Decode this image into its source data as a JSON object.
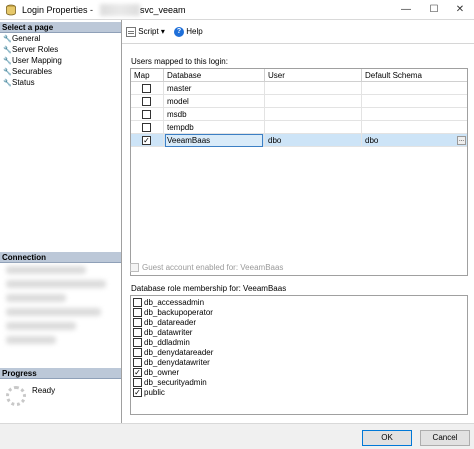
{
  "window": {
    "title": "Login Properties -",
    "login_name": "svc_veeam",
    "min_glyph": "—",
    "max_glyph": "☐",
    "close_glyph": "✕"
  },
  "left": {
    "select_header": "Select a page",
    "pages": [
      {
        "label": "General",
        "icon": "wrench-icon"
      },
      {
        "label": "Server Roles",
        "icon": "wrench-icon"
      },
      {
        "label": "User Mapping",
        "icon": "wrench-icon"
      },
      {
        "label": "Securables",
        "icon": "wrench-icon"
      },
      {
        "label": "Status",
        "icon": "wrench-icon"
      }
    ],
    "connection_header": "Connection",
    "progress_header": "Progress",
    "progress_status": "Ready"
  },
  "toolbar": {
    "script_label": "Script",
    "dropdown_glyph": "▾",
    "help_label": "Help",
    "help_glyph": "?"
  },
  "mapping": {
    "label": "Users mapped to this login:",
    "columns": [
      "Map",
      "Database",
      "User",
      "Default Schema"
    ],
    "rows": [
      {
        "checked": false,
        "database": "master",
        "user": "",
        "schema": ""
      },
      {
        "checked": false,
        "database": "model",
        "user": "",
        "schema": ""
      },
      {
        "checked": false,
        "database": "msdb",
        "user": "",
        "schema": ""
      },
      {
        "checked": false,
        "database": "tempdb",
        "user": "",
        "schema": ""
      },
      {
        "checked": true,
        "database": "VeeamBaas",
        "user": "dbo",
        "schema": "dbo"
      }
    ],
    "ellipsis": "..."
  },
  "guest": {
    "label": "Guest account enabled for: VeeamBaas"
  },
  "roles": {
    "label": "Database role membership for: VeeamBaas",
    "items": [
      {
        "name": "db_accessadmin",
        "checked": false
      },
      {
        "name": "db_backupoperator",
        "checked": false
      },
      {
        "name": "db_datareader",
        "checked": false
      },
      {
        "name": "db_datawriter",
        "checked": false
      },
      {
        "name": "db_ddladmin",
        "checked": false
      },
      {
        "name": "db_denydatareader",
        "checked": false
      },
      {
        "name": "db_denydatawriter",
        "checked": false
      },
      {
        "name": "db_owner",
        "checked": true
      },
      {
        "name": "db_securityadmin",
        "checked": false
      },
      {
        "name": "public",
        "checked": true
      }
    ]
  },
  "buttons": {
    "ok": "OK",
    "cancel": "Cancel"
  },
  "colors": {
    "selection": "#cde4f7",
    "header": "#bcc8d8",
    "help": "#1e6fd9"
  }
}
